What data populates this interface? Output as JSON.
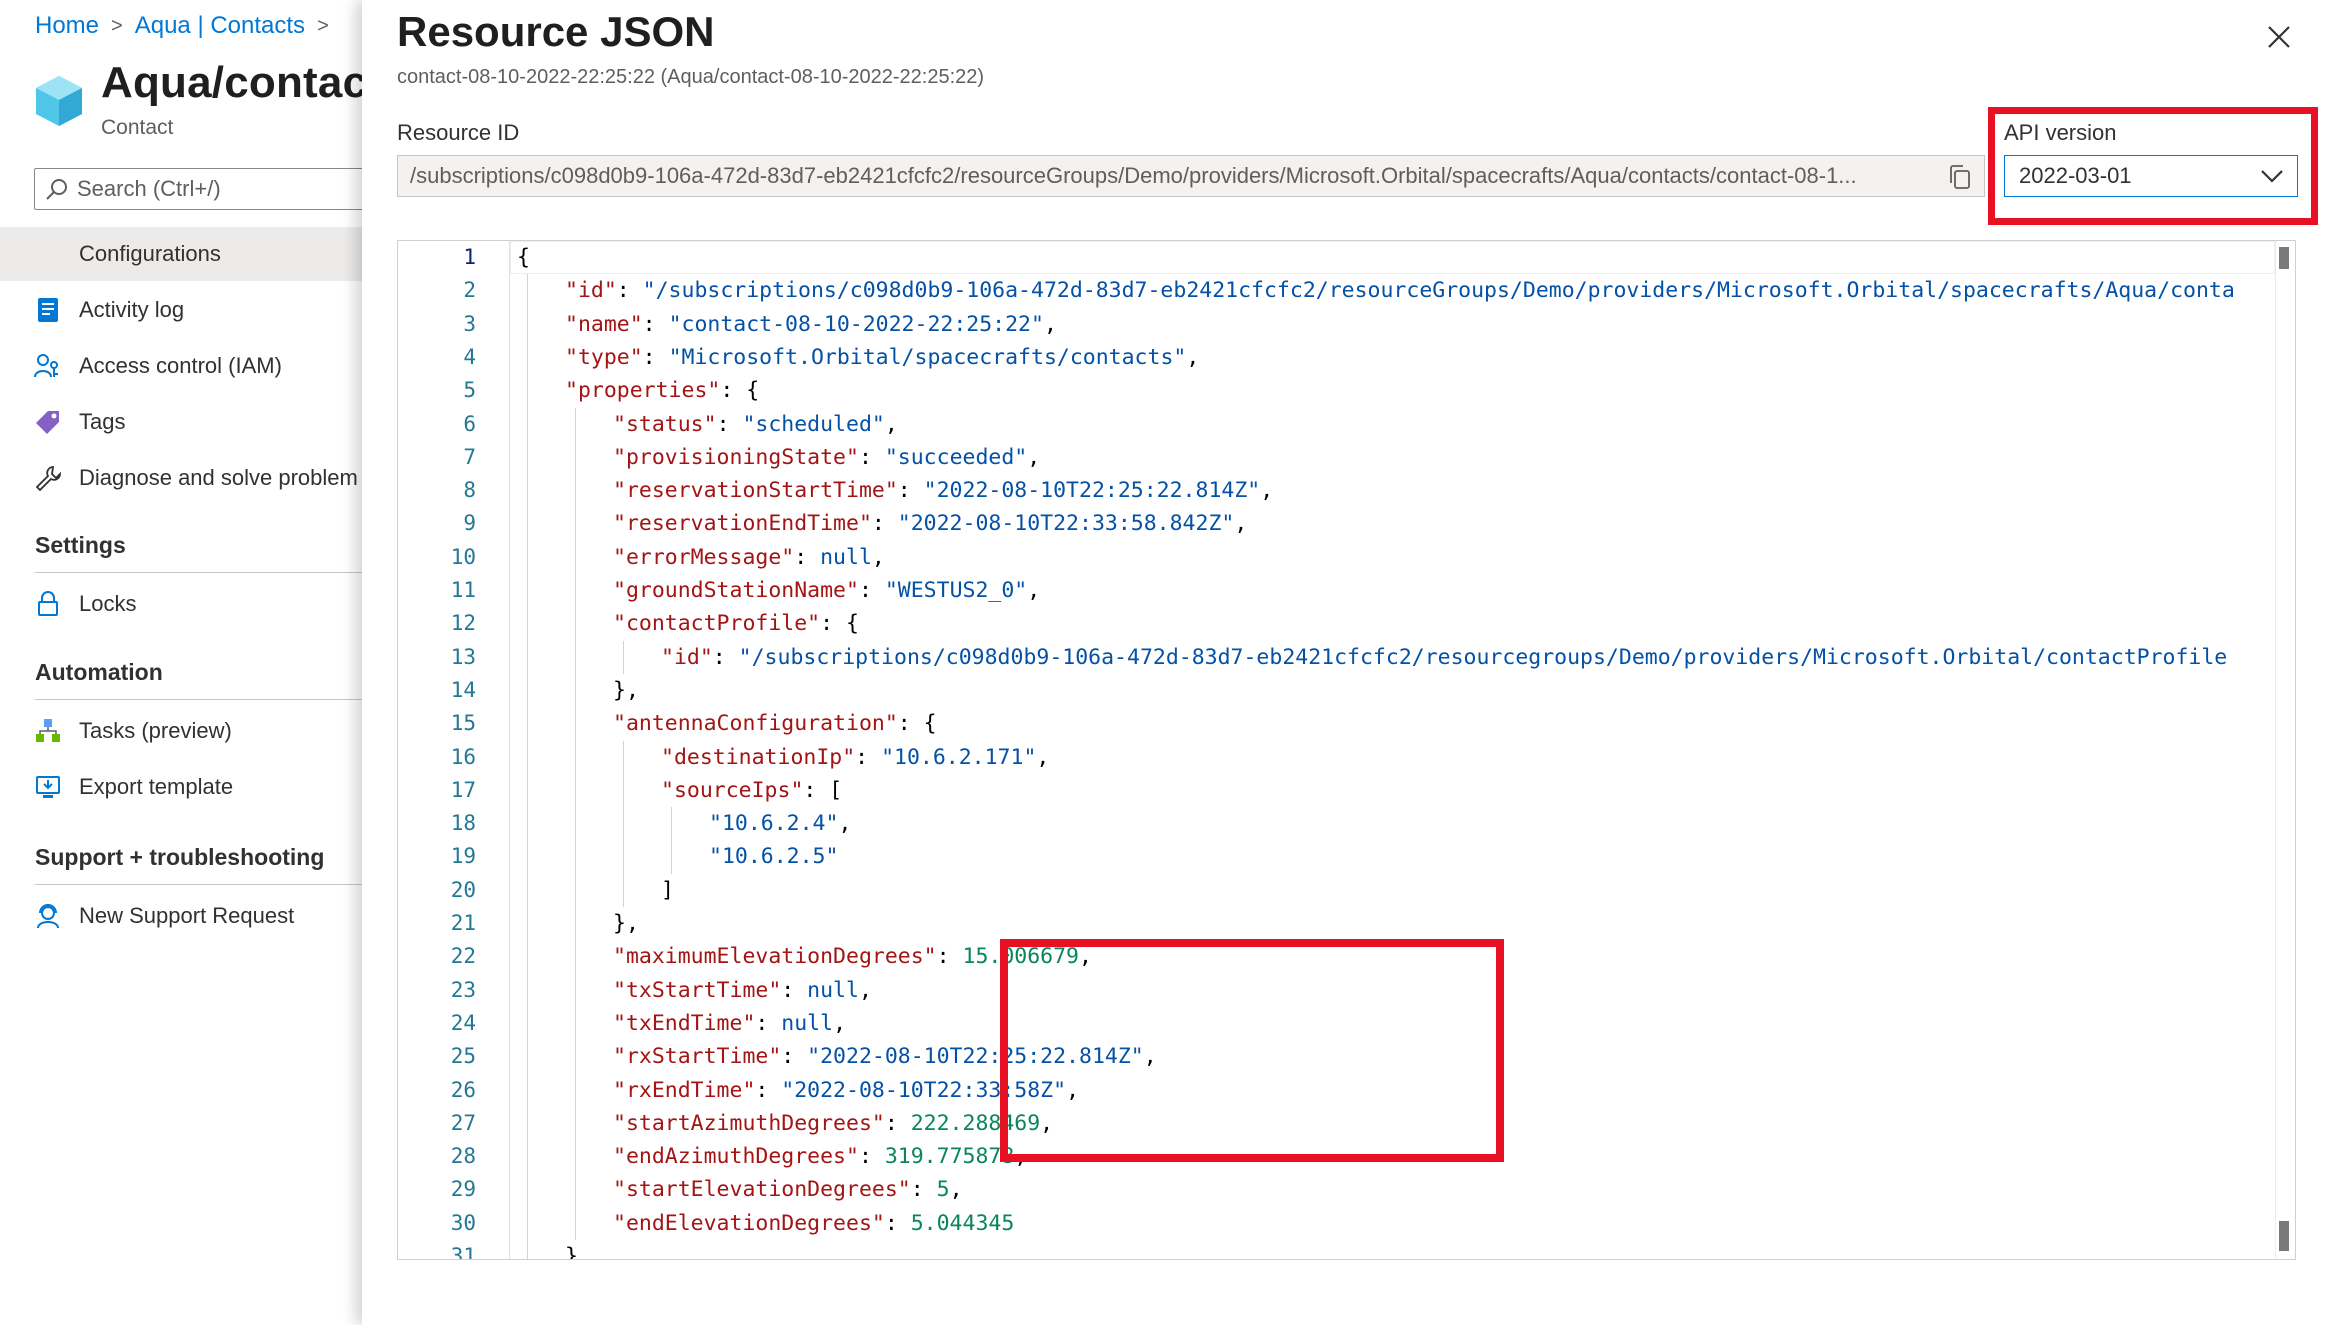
{
  "breadcrumb": [
    "Home",
    "Aqua | Contacts"
  ],
  "resource": {
    "title": "Aqua/contact",
    "subtitle": "Contact"
  },
  "search": {
    "placeholder": "Search (Ctrl+/)"
  },
  "nav": {
    "items": [
      {
        "label": "Configurations",
        "icon": "configurations-icon",
        "selected": true
      },
      {
        "label": "Activity log",
        "icon": "activity-log-icon"
      },
      {
        "label": "Access control (IAM)",
        "icon": "access-control-icon"
      },
      {
        "label": "Tags",
        "icon": "tag-icon"
      },
      {
        "label": "Diagnose and solve problem",
        "icon": "wrench-icon"
      }
    ],
    "settings": {
      "header": "Settings",
      "items": [
        {
          "label": "Locks",
          "icon": "lock-icon"
        }
      ]
    },
    "automation": {
      "header": "Automation",
      "items": [
        {
          "label": "Tasks (preview)",
          "icon": "tasks-icon"
        },
        {
          "label": "Export template",
          "icon": "export-template-icon"
        }
      ]
    },
    "support": {
      "header": "Support + troubleshooting",
      "items": [
        {
          "label": "New Support Request",
          "icon": "support-request-icon"
        }
      ]
    }
  },
  "panel": {
    "title": "Resource JSON",
    "subtitle": "contact-08-10-2022-22:25:22 (Aqua/contact-08-10-2022-22:25:22)",
    "resource_id_label": "Resource ID",
    "resource_id_value": "/subscriptions/c098d0b9-106a-472d-83d7-eb2421cfcfc2/resourceGroups/Demo/providers/Microsoft.Orbital/spacecrafts/Aqua/contacts/contact-08-1...",
    "api_version_label": "API version",
    "api_version_value": "2022-03-01"
  },
  "colors": {
    "accent": "#0078d4",
    "highlight": "#e81123",
    "json_key": "#a31515",
    "json_string": "#0451a5",
    "json_number": "#098658"
  },
  "editor": {
    "active_line": 1,
    "lines": [
      {
        "n": "1",
        "indent": 0,
        "parts": [
          [
            "p",
            "{"
          ]
        ]
      },
      {
        "n": "2",
        "indent": 1,
        "parts": [
          [
            "k",
            "\"id\""
          ],
          [
            "p",
            ": "
          ],
          [
            "s",
            "\"/subscriptions/c098d0b9-106a-472d-83d7-eb2421cfcfc2/resourceGroups/Demo/providers/Microsoft.Orbital/spacecrafts/Aqua/conta"
          ]
        ]
      },
      {
        "n": "3",
        "indent": 1,
        "parts": [
          [
            "k",
            "\"name\""
          ],
          [
            "p",
            ": "
          ],
          [
            "s",
            "\"contact-08-10-2022-22:25:22\""
          ],
          [
            "p",
            ","
          ]
        ]
      },
      {
        "n": "4",
        "indent": 1,
        "parts": [
          [
            "k",
            "\"type\""
          ],
          [
            "p",
            ": "
          ],
          [
            "s",
            "\"Microsoft.Orbital/spacecrafts/contacts\""
          ],
          [
            "p",
            ","
          ]
        ]
      },
      {
        "n": "5",
        "indent": 1,
        "parts": [
          [
            "k",
            "\"properties\""
          ],
          [
            "p",
            ": {"
          ]
        ]
      },
      {
        "n": "6",
        "indent": 2,
        "parts": [
          [
            "k",
            "\"status\""
          ],
          [
            "p",
            ": "
          ],
          [
            "s",
            "\"scheduled\""
          ],
          [
            "p",
            ","
          ]
        ]
      },
      {
        "n": "7",
        "indent": 2,
        "parts": [
          [
            "k",
            "\"provisioningState\""
          ],
          [
            "p",
            ": "
          ],
          [
            "s",
            "\"succeeded\""
          ],
          [
            "p",
            ","
          ]
        ]
      },
      {
        "n": "8",
        "indent": 2,
        "parts": [
          [
            "k",
            "\"reservationStartTime\""
          ],
          [
            "p",
            ": "
          ],
          [
            "s",
            "\"2022-08-10T22:25:22.814Z\""
          ],
          [
            "p",
            ","
          ]
        ]
      },
      {
        "n": "9",
        "indent": 2,
        "parts": [
          [
            "k",
            "\"reservationEndTime\""
          ],
          [
            "p",
            ": "
          ],
          [
            "s",
            "\"2022-08-10T22:33:58.842Z\""
          ],
          [
            "p",
            ","
          ]
        ]
      },
      {
        "n": "10",
        "indent": 2,
        "parts": [
          [
            "k",
            "\"errorMessage\""
          ],
          [
            "p",
            ": "
          ],
          [
            "b",
            "null"
          ],
          [
            "p",
            ","
          ]
        ]
      },
      {
        "n": "11",
        "indent": 2,
        "parts": [
          [
            "k",
            "\"groundStationName\""
          ],
          [
            "p",
            ": "
          ],
          [
            "s",
            "\"WESTUS2_0\""
          ],
          [
            "p",
            ","
          ]
        ]
      },
      {
        "n": "12",
        "indent": 2,
        "parts": [
          [
            "k",
            "\"contactProfile\""
          ],
          [
            "p",
            ": {"
          ]
        ]
      },
      {
        "n": "13",
        "indent": 3,
        "parts": [
          [
            "k",
            "\"id\""
          ],
          [
            "p",
            ": "
          ],
          [
            "s",
            "\"/subscriptions/c098d0b9-106a-472d-83d7-eb2421cfcfc2/resourcegroups/Demo/providers/Microsoft.Orbital/contactProfile"
          ]
        ]
      },
      {
        "n": "14",
        "indent": 2,
        "parts": [
          [
            "p",
            "},"
          ]
        ]
      },
      {
        "n": "15",
        "indent": 2,
        "parts": [
          [
            "k",
            "\"antennaConfiguration\""
          ],
          [
            "p",
            ": {"
          ]
        ]
      },
      {
        "n": "16",
        "indent": 3,
        "parts": [
          [
            "k",
            "\"destinationIp\""
          ],
          [
            "p",
            ": "
          ],
          [
            "s",
            "\"10.6.2.171\""
          ],
          [
            "p",
            ","
          ]
        ]
      },
      {
        "n": "17",
        "indent": 3,
        "parts": [
          [
            "k",
            "\"sourceIps\""
          ],
          [
            "p",
            ": ["
          ]
        ]
      },
      {
        "n": "18",
        "indent": 4,
        "parts": [
          [
            "s",
            "\"10.6.2.4\""
          ],
          [
            "p",
            ","
          ]
        ]
      },
      {
        "n": "19",
        "indent": 4,
        "parts": [
          [
            "s",
            "\"10.6.2.5\""
          ]
        ]
      },
      {
        "n": "20",
        "indent": 3,
        "parts": [
          [
            "p",
            "]"
          ]
        ]
      },
      {
        "n": "21",
        "indent": 2,
        "parts": [
          [
            "p",
            "},"
          ]
        ]
      },
      {
        "n": "22",
        "indent": 2,
        "parts": [
          [
            "k",
            "\"maximumElevationDegrees\""
          ],
          [
            "p",
            ": "
          ],
          [
            "n",
            "15.006679"
          ],
          [
            "p",
            ","
          ]
        ]
      },
      {
        "n": "23",
        "indent": 2,
        "parts": [
          [
            "k",
            "\"txStartTime\""
          ],
          [
            "p",
            ": "
          ],
          [
            "b",
            "null"
          ],
          [
            "p",
            ","
          ]
        ]
      },
      {
        "n": "24",
        "indent": 2,
        "parts": [
          [
            "k",
            "\"txEndTime\""
          ],
          [
            "p",
            ": "
          ],
          [
            "b",
            "null"
          ],
          [
            "p",
            ","
          ]
        ]
      },
      {
        "n": "25",
        "indent": 2,
        "parts": [
          [
            "k",
            "\"rxStartTime\""
          ],
          [
            "p",
            ": "
          ],
          [
            "s",
            "\"2022-08-10T22:25:22.814Z\""
          ],
          [
            "p",
            ","
          ]
        ]
      },
      {
        "n": "26",
        "indent": 2,
        "parts": [
          [
            "k",
            "\"rxEndTime\""
          ],
          [
            "p",
            ": "
          ],
          [
            "s",
            "\"2022-08-10T22:33:58Z\""
          ],
          [
            "p",
            ","
          ]
        ]
      },
      {
        "n": "27",
        "indent": 2,
        "parts": [
          [
            "k",
            "\"startAzimuthDegrees\""
          ],
          [
            "p",
            ": "
          ],
          [
            "n",
            "222.288469"
          ],
          [
            "p",
            ","
          ]
        ]
      },
      {
        "n": "28",
        "indent": 2,
        "parts": [
          [
            "k",
            "\"endAzimuthDegrees\""
          ],
          [
            "p",
            ": "
          ],
          [
            "n",
            "319.775878"
          ],
          [
            "p",
            ","
          ]
        ]
      },
      {
        "n": "29",
        "indent": 2,
        "parts": [
          [
            "k",
            "\"startElevationDegrees\""
          ],
          [
            "p",
            ": "
          ],
          [
            "n",
            "5"
          ],
          [
            "p",
            ","
          ]
        ]
      },
      {
        "n": "30",
        "indent": 2,
        "parts": [
          [
            "k",
            "\"endElevationDegrees\""
          ],
          [
            "p",
            ": "
          ],
          [
            "n",
            "5.044345"
          ]
        ]
      },
      {
        "n": "31",
        "indent": 1,
        "parts": [
          [
            "p",
            "},"
          ]
        ]
      }
    ]
  }
}
